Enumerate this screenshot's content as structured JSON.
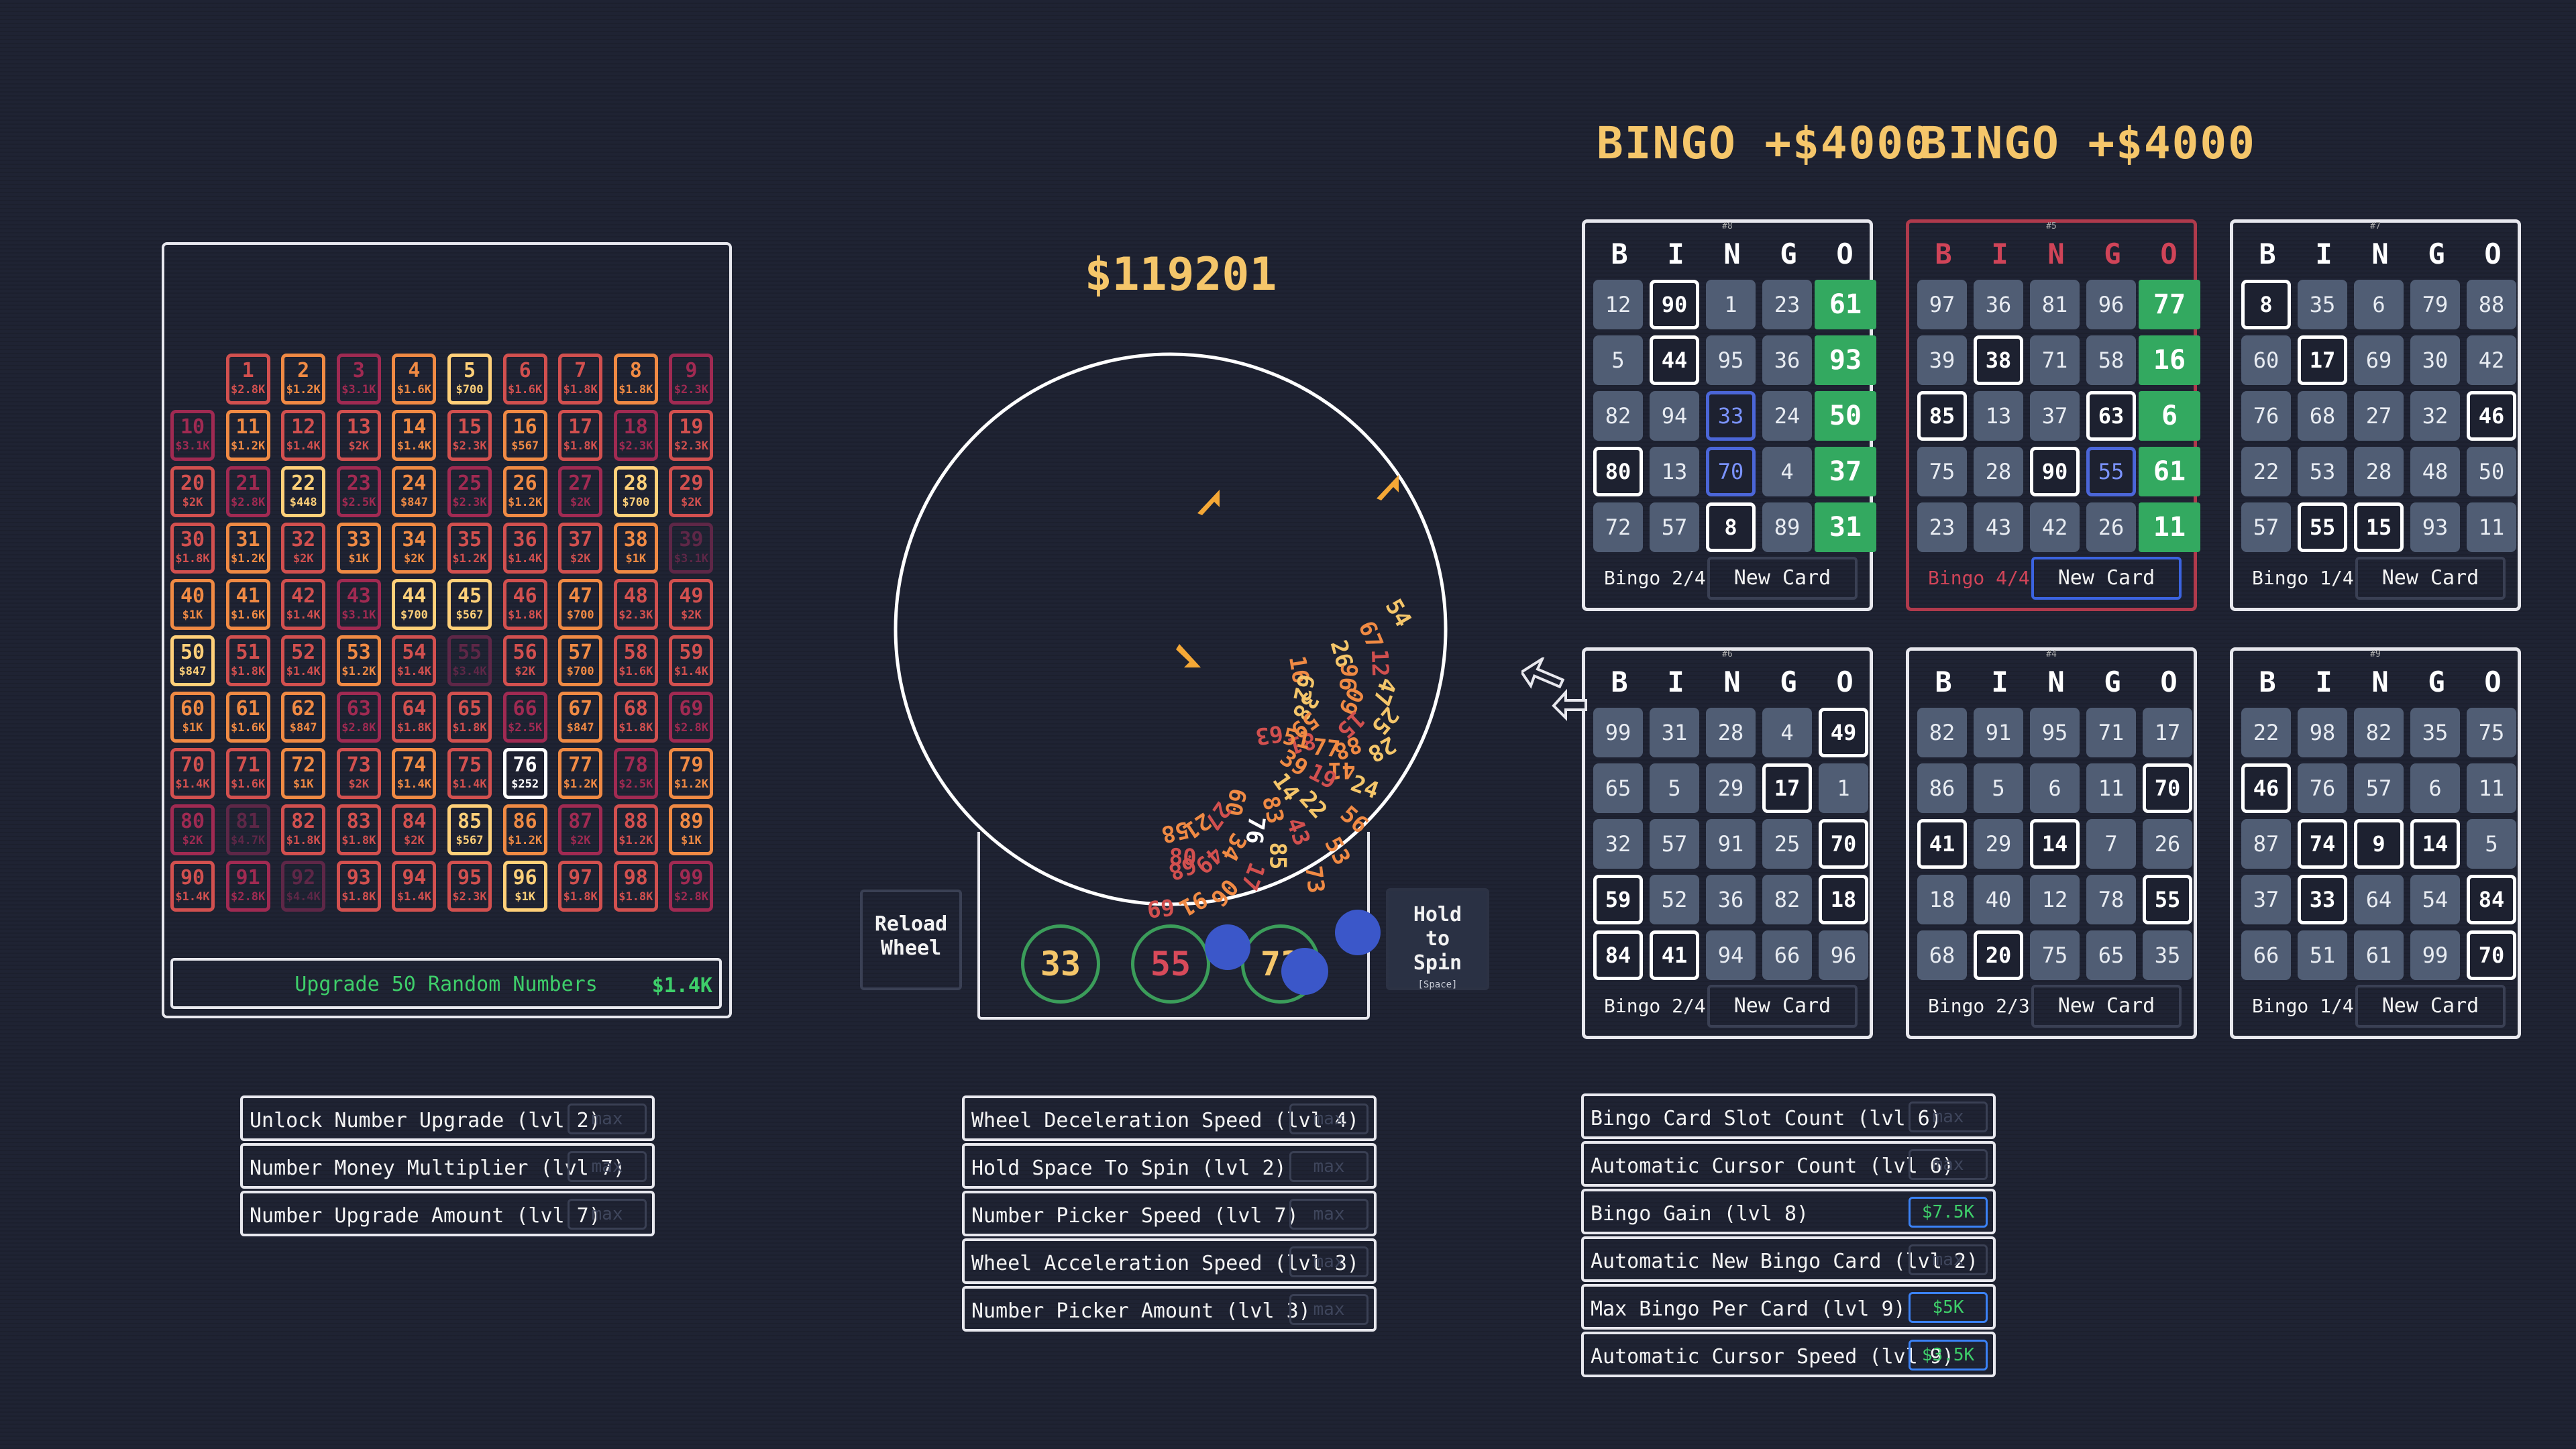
{
  "money": "$119201",
  "grid": {
    "rows": [
      [
        null,
        [
          "1",
          "$2.8K",
          3
        ],
        [
          "2",
          "$1.2K",
          4
        ],
        [
          "3",
          "$3.1K",
          2
        ],
        [
          "4",
          "$1.6K",
          4
        ],
        [
          "5",
          "$700",
          5
        ],
        [
          "6",
          "$1.6K",
          3
        ],
        [
          "7",
          "$1.8K",
          3
        ],
        [
          "8",
          "$1.8K",
          4
        ],
        [
          "9",
          "$2.3K",
          2
        ]
      ],
      [
        [
          "10",
          "$3.1K",
          2
        ],
        [
          "11",
          "$1.2K",
          4
        ],
        [
          "12",
          "$1.4K",
          3
        ],
        [
          "13",
          "$2K",
          3
        ],
        [
          "14",
          "$1.4K",
          4
        ],
        [
          "15",
          "$2.3K",
          3
        ],
        [
          "16",
          "$567",
          4
        ],
        [
          "17",
          "$1.8K",
          3
        ],
        [
          "18",
          "$2.3K",
          2
        ],
        [
          "19",
          "$2.3K",
          3
        ]
      ],
      [
        [
          "20",
          "$2K",
          3
        ],
        [
          "21",
          "$2.8K",
          2
        ],
        [
          "22",
          "$448",
          5
        ],
        [
          "23",
          "$2.5K",
          2
        ],
        [
          "24",
          "$847",
          4
        ],
        [
          "25",
          "$2.3K",
          2
        ],
        [
          "26",
          "$1.2K",
          4
        ],
        [
          "27",
          "$2K",
          2
        ],
        [
          "28",
          "$700",
          5
        ],
        [
          "29",
          "$2K",
          3
        ]
      ],
      [
        [
          "30",
          "$1.8K",
          3
        ],
        [
          "31",
          "$1.2K",
          4
        ],
        [
          "32",
          "$2K",
          3
        ],
        [
          "33",
          "$1K",
          4
        ],
        [
          "34",
          "$2K",
          4
        ],
        [
          "35",
          "$1.2K",
          3
        ],
        [
          "36",
          "$1.4K",
          3
        ],
        [
          "37",
          "$2K",
          3
        ],
        [
          "38",
          "$1K",
          4
        ],
        [
          "39",
          "$3.1K",
          1
        ]
      ],
      [
        [
          "40",
          "$1K",
          4
        ],
        [
          "41",
          "$1.6K",
          4
        ],
        [
          "42",
          "$1.4K",
          3
        ],
        [
          "43",
          "$3.1K",
          2
        ],
        [
          "44",
          "$700",
          5
        ],
        [
          "45",
          "$567",
          5
        ],
        [
          "46",
          "$1.8K",
          3
        ],
        [
          "47",
          "$700",
          4
        ],
        [
          "48",
          "$2.3K",
          3
        ],
        [
          "49",
          "$2K",
          3
        ]
      ],
      [
        [
          "50",
          "$847",
          5
        ],
        [
          "51",
          "$1.8K",
          3
        ],
        [
          "52",
          "$1.4K",
          3
        ],
        [
          "53",
          "$1.2K",
          4
        ],
        [
          "54",
          "$1.4K",
          3
        ],
        [
          "55",
          "$3.4K",
          1
        ],
        [
          "56",
          "$2K",
          3
        ],
        [
          "57",
          "$700",
          4
        ],
        [
          "58",
          "$1.6K",
          3
        ],
        [
          "59",
          "$1.4K",
          3
        ]
      ],
      [
        [
          "60",
          "$1K",
          4
        ],
        [
          "61",
          "$1.6K",
          4
        ],
        [
          "62",
          "$847",
          4
        ],
        [
          "63",
          "$2.8K",
          2
        ],
        [
          "64",
          "$1.8K",
          3
        ],
        [
          "65",
          "$1.8K",
          3
        ],
        [
          "66",
          "$2.5K",
          2
        ],
        [
          "67",
          "$847",
          4
        ],
        [
          "68",
          "$1.8K",
          3
        ],
        [
          "69",
          "$2.8K",
          2
        ]
      ],
      [
        [
          "70",
          "$1.4K",
          3
        ],
        [
          "71",
          "$1.6K",
          3
        ],
        [
          "72",
          "$1K",
          4
        ],
        [
          "73",
          "$2K",
          3
        ],
        [
          "74",
          "$1.4K",
          4
        ],
        [
          "75",
          "$1.4K",
          3
        ],
        [
          "76",
          "$252",
          6
        ],
        [
          "77",
          "$1.2K",
          4
        ],
        [
          "78",
          "$2.5K",
          2
        ],
        [
          "79",
          "$1.2K",
          4
        ]
      ],
      [
        [
          "80",
          "$2K",
          2
        ],
        [
          "81",
          "$4.7K",
          1
        ],
        [
          "82",
          "$1.8K",
          3
        ],
        [
          "83",
          "$1.8K",
          3
        ],
        [
          "84",
          "$2K",
          3
        ],
        [
          "85",
          "$567",
          5
        ],
        [
          "86",
          "$1.2K",
          4
        ],
        [
          "87",
          "$2K",
          2
        ],
        [
          "88",
          "$1.2K",
          3
        ],
        [
          "89",
          "$1K",
          4
        ]
      ],
      [
        [
          "90",
          "$1.4K",
          3
        ],
        [
          "91",
          "$2.8K",
          2
        ],
        [
          "92",
          "$4.4K",
          1
        ],
        [
          "93",
          "$1.8K",
          3
        ],
        [
          "94",
          "$1.4K",
          3
        ],
        [
          "95",
          "$2.3K",
          3
        ],
        [
          "96",
          "$1K",
          5
        ],
        [
          "97",
          "$1.8K",
          3
        ],
        [
          "98",
          "$1.8K",
          3
        ],
        [
          "99",
          "$2.8K",
          2
        ]
      ]
    ],
    "tier_colors": {
      "1": "#5e2747",
      "2": "#a02a52",
      "3": "#d2504f",
      "4": "#f08a44",
      "5": "#ffd079",
      "6": "#ffffff"
    }
  },
  "grid_upgrade": {
    "label": "Upgrade 50 Random Numbers",
    "cost": "$1.4K"
  },
  "upgrades_left": [
    {
      "label": "Unlock Number Upgrade (lvl 2)",
      "cost": "max",
      "buy": false
    },
    {
      "label": "Number Money Multiplier (lvl 7)",
      "cost": "max",
      "buy": false
    },
    {
      "label": "Number Upgrade Amount (lvl 7)",
      "cost": "max",
      "buy": false
    }
  ],
  "upgrades_mid": [
    {
      "label": "Wheel Deceleration Speed (lvl 4)",
      "cost": "max",
      "buy": false
    },
    {
      "label": "Hold Space To Spin (lvl 2)",
      "cost": "max",
      "buy": false
    },
    {
      "label": "Number Picker Speed (lvl 7)",
      "cost": "max",
      "buy": false
    },
    {
      "label": "Wheel Acceleration Speed (lvl 3)",
      "cost": "max",
      "buy": false
    },
    {
      "label": "Number Picker Amount (lvl 3)",
      "cost": "max",
      "buy": false
    }
  ],
  "upgrades_right": [
    {
      "label": "Bingo Card Slot Count (lvl 6)",
      "cost": "max",
      "buy": false
    },
    {
      "label": "Automatic Cursor Count (lvl 6)",
      "cost": "max",
      "buy": false
    },
    {
      "label": "Bingo Gain (lvl 8)",
      "cost": "$7.5K",
      "buy": true
    },
    {
      "label": "Automatic New Bingo Card (lvl 2)",
      "cost": "max",
      "buy": false
    },
    {
      "label": "Max Bingo Per Card (lvl 9)",
      "cost": "$5K",
      "buy": true
    },
    {
      "label": "Automatic Cursor Speed (lvl 9)",
      "cost": "$3.5K",
      "buy": true
    }
  ],
  "reload_button": "Reload Wheel",
  "spin_button": {
    "label": "Hold to Spin",
    "hint": "[Space]"
  },
  "drawn_balls": [
    {
      "num": "33",
      "color": "#f5c66a"
    },
    {
      "num": "55",
      "color": "#d84a5a"
    },
    {
      "num": "73",
      "color": "#f5c66a"
    }
  ],
  "bingo_banners": [
    "BINGO +$4000",
    "BINGO +$4000"
  ],
  "bingo_header": [
    "B",
    "I",
    "N",
    "G",
    "O"
  ],
  "new_card_label": "New Card",
  "cards": [
    {
      "id": "#8",
      "red": false,
      "status": "Bingo 2/4",
      "cells": [
        [
          "12",
          "n"
        ],
        [
          "90",
          "m"
        ],
        [
          "1",
          "n"
        ],
        [
          "23",
          "n"
        ],
        [
          "61",
          "g"
        ],
        [
          "5",
          "n"
        ],
        [
          "44",
          "m"
        ],
        [
          "95",
          "n"
        ],
        [
          "36",
          "n"
        ],
        [
          "93",
          "g"
        ],
        [
          "82",
          "n"
        ],
        [
          "94",
          "n"
        ],
        [
          "33",
          "b"
        ],
        [
          "24",
          "n"
        ],
        [
          "50",
          "g"
        ],
        [
          "80",
          "m"
        ],
        [
          "13",
          "n"
        ],
        [
          "70",
          "b"
        ],
        [
          "4",
          "n"
        ],
        [
          "37",
          "g"
        ],
        [
          "72",
          "n"
        ],
        [
          "57",
          "n"
        ],
        [
          "8",
          "m"
        ],
        [
          "89",
          "n"
        ],
        [
          "31",
          "g"
        ]
      ]
    },
    {
      "id": "#5",
      "red": true,
      "status": "Bingo 4/4",
      "cells": [
        [
          "97",
          "n"
        ],
        [
          "36",
          "n"
        ],
        [
          "81",
          "n"
        ],
        [
          "96",
          "n"
        ],
        [
          "77",
          "g"
        ],
        [
          "39",
          "n"
        ],
        [
          "38",
          "m"
        ],
        [
          "71",
          "n"
        ],
        [
          "58",
          "n"
        ],
        [
          "16",
          "g"
        ],
        [
          "85",
          "m"
        ],
        [
          "13",
          "n"
        ],
        [
          "37",
          "n"
        ],
        [
          "63",
          "m"
        ],
        [
          "6",
          "g"
        ],
        [
          "75",
          "n"
        ],
        [
          "28",
          "n"
        ],
        [
          "90",
          "m"
        ],
        [
          "55",
          "b"
        ],
        [
          "61",
          "g"
        ],
        [
          "23",
          "n"
        ],
        [
          "43",
          "n"
        ],
        [
          "42",
          "n"
        ],
        [
          "26",
          "n"
        ],
        [
          "11",
          "g"
        ]
      ]
    },
    {
      "id": "#7",
      "red": false,
      "status": "Bingo 1/4",
      "cells": [
        [
          "8",
          "m"
        ],
        [
          "35",
          "n"
        ],
        [
          "6",
          "n"
        ],
        [
          "79",
          "n"
        ],
        [
          "88",
          "n"
        ],
        [
          "60",
          "n"
        ],
        [
          "17",
          "m"
        ],
        [
          "69",
          "n"
        ],
        [
          "30",
          "n"
        ],
        [
          "42",
          "n"
        ],
        [
          "76",
          "n"
        ],
        [
          "68",
          "n"
        ],
        [
          "27",
          "n"
        ],
        [
          "32",
          "n"
        ],
        [
          "46",
          "m"
        ],
        [
          "22",
          "n"
        ],
        [
          "53",
          "n"
        ],
        [
          "28",
          "n"
        ],
        [
          "48",
          "n"
        ],
        [
          "50",
          "n"
        ],
        [
          "57",
          "n"
        ],
        [
          "55",
          "m"
        ],
        [
          "15",
          "m"
        ],
        [
          "93",
          "n"
        ],
        [
          "11",
          "n"
        ]
      ]
    },
    {
      "id": "#6",
      "red": false,
      "status": "Bingo 2/4",
      "cells": [
        [
          "99",
          "n"
        ],
        [
          "31",
          "n"
        ],
        [
          "28",
          "n"
        ],
        [
          "4",
          "n"
        ],
        [
          "49",
          "m"
        ],
        [
          "65",
          "n"
        ],
        [
          "5",
          "n"
        ],
        [
          "29",
          "n"
        ],
        [
          "17",
          "m"
        ],
        [
          "1",
          "n"
        ],
        [
          "32",
          "n"
        ],
        [
          "57",
          "n"
        ],
        [
          "91",
          "n"
        ],
        [
          "25",
          "n"
        ],
        [
          "70",
          "m"
        ],
        [
          "59",
          "m"
        ],
        [
          "52",
          "n"
        ],
        [
          "36",
          "n"
        ],
        [
          "82",
          "n"
        ],
        [
          "18",
          "m"
        ],
        [
          "84",
          "m"
        ],
        [
          "41",
          "m"
        ],
        [
          "94",
          "n"
        ],
        [
          "66",
          "n"
        ],
        [
          "96",
          "n"
        ]
      ]
    },
    {
      "id": "#4",
      "red": false,
      "status": "Bingo 2/3",
      "cells": [
        [
          "82",
          "n"
        ],
        [
          "91",
          "n"
        ],
        [
          "95",
          "n"
        ],
        [
          "71",
          "n"
        ],
        [
          "17",
          "n"
        ],
        [
          "86",
          "n"
        ],
        [
          "5",
          "n"
        ],
        [
          "6",
          "n"
        ],
        [
          "11",
          "n"
        ],
        [
          "70",
          "m"
        ],
        [
          "41",
          "m"
        ],
        [
          "29",
          "n"
        ],
        [
          "14",
          "m"
        ],
        [
          "7",
          "n"
        ],
        [
          "26",
          "n"
        ],
        [
          "18",
          "n"
        ],
        [
          "40",
          "n"
        ],
        [
          "12",
          "n"
        ],
        [
          "78",
          "n"
        ],
        [
          "55",
          "m"
        ],
        [
          "68",
          "n"
        ],
        [
          "20",
          "m"
        ],
        [
          "75",
          "n"
        ],
        [
          "65",
          "n"
        ],
        [
          "35",
          "n"
        ]
      ]
    },
    {
      "id": "#9",
      "red": false,
      "status": "Bingo 1/4",
      "cells": [
        [
          "22",
          "n"
        ],
        [
          "98",
          "n"
        ],
        [
          "82",
          "n"
        ],
        [
          "35",
          "n"
        ],
        [
          "75",
          "n"
        ],
        [
          "46",
          "m"
        ],
        [
          "76",
          "n"
        ],
        [
          "57",
          "n"
        ],
        [
          "6",
          "n"
        ],
        [
          "11",
          "n"
        ],
        [
          "87",
          "n"
        ],
        [
          "74",
          "m"
        ],
        [
          "9",
          "m"
        ],
        [
          "14",
          "m"
        ],
        [
          "5",
          "n"
        ],
        [
          "37",
          "n"
        ],
        [
          "33",
          "m"
        ],
        [
          "64",
          "n"
        ],
        [
          "54",
          "n"
        ],
        [
          "84",
          "m"
        ],
        [
          "66",
          "n"
        ],
        [
          "51",
          "n"
        ],
        [
          "61",
          "n"
        ],
        [
          "99",
          "n"
        ],
        [
          "70",
          "m"
        ]
      ]
    }
  ],
  "wheel_numbers": [
    [
      "54",
      "#f5c66a"
    ],
    [
      "67",
      "#f08a44"
    ],
    [
      "26",
      "#f5c66a"
    ],
    [
      "16",
      "#f08a44"
    ],
    [
      "12",
      "#d2504f"
    ],
    [
      "96",
      "#f08a44"
    ],
    [
      "62",
      "#f5c66a"
    ],
    [
      "47",
      "#f5c66a"
    ],
    [
      "09",
      "#f08a44"
    ],
    [
      "38",
      "#f5c66a"
    ],
    [
      "25",
      "#f5c66a"
    ],
    [
      "15",
      "#d2504f"
    ],
    [
      "59",
      "#f08a44"
    ],
    [
      "28",
      "#f5c66a"
    ],
    [
      "88",
      "#f08a44"
    ],
    [
      "81",
      "#d2504f"
    ],
    [
      "63",
      "#d2504f"
    ],
    [
      "41",
      "#f08a44"
    ],
    [
      "77",
      "#f08a44"
    ],
    [
      "51",
      "#f08a44"
    ],
    [
      "24",
      "#f5c66a"
    ],
    [
      "19",
      "#d2504f"
    ],
    [
      "39",
      "#f08a44"
    ],
    [
      "56",
      "#f08a44"
    ],
    [
      "22",
      "#f5c66a"
    ],
    [
      "14",
      "#f5c66a"
    ],
    [
      "53",
      "#f08a44"
    ],
    [
      "43",
      "#d2504f"
    ],
    [
      "83",
      "#f08a44"
    ],
    [
      "73",
      "#f08a44"
    ],
    [
      "85",
      "#f5c66a"
    ],
    [
      "76",
      "#ffffff"
    ],
    [
      "60",
      "#f08a44"
    ],
    [
      "17",
      "#d2504f"
    ],
    [
      "34",
      "#f08a44"
    ],
    [
      "27",
      "#d2504f"
    ],
    [
      "06",
      "#f08a44"
    ],
    [
      "49",
      "#d2504f"
    ],
    [
      "21",
      "#f08a44"
    ],
    [
      "91",
      "#f08a44"
    ],
    [
      "68",
      "#d2504f"
    ],
    [
      "58",
      "#f08a44"
    ],
    [
      "69",
      "#d2504f"
    ],
    [
      "80",
      "#d2504f"
    ]
  ]
}
